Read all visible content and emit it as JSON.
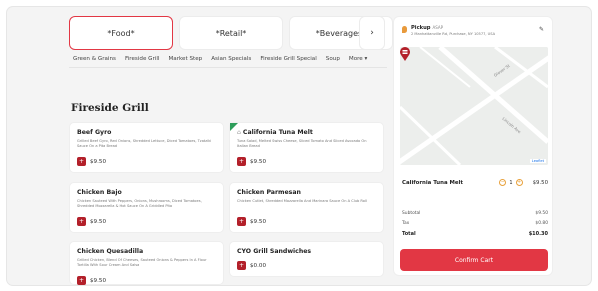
{
  "categories": [
    {
      "label": "*Food*",
      "active": true
    },
    {
      "label": "*Retail*",
      "active": false
    },
    {
      "label": "*Beverages*",
      "active": false
    }
  ],
  "category_next": "›",
  "subcategories": [
    "Green & Grains",
    "Fireside Grill",
    "Market Step",
    "Asian Specials",
    "Fireside Grill Special",
    "Soup",
    "More ▾"
  ],
  "section_title": "Fireside Grill",
  "items": [
    {
      "name": "Beef Gyro",
      "desc": "Grilled Beef Gyro, Red Onions, Shredded Lettuce, Diced Tomatoes, Tzatziki Sauce On a Pita Bread",
      "price": "$9.50"
    },
    {
      "name": "California Tuna Melt",
      "desc": "Tuna Salad, Melted Swiss Cheese, Sliced Tomato And Sliced Avocado On Italian Bread",
      "price": "$9.50"
    },
    {
      "name": "Chicken Bajo",
      "desc": "Chicken Sauteed With Peppers, Onions, Mushrooms, Diced Tomatoes, Shredded Mozzarella & Hot Sauce On A Griddled Pita",
      "price": "$9.50"
    },
    {
      "name": "Chicken Parmesan",
      "desc": "Chicken Cutlet, Shredded Mozzarella And Marinara Sauce On A Club Roll",
      "price": "$9.50"
    },
    {
      "name": "Chicken Quesadilla",
      "desc": "Grilled Chicken, Blend Of Cheeses, Sauteed Onions & Peppers In A Flour Tortilla With Sour Cream And Salsa",
      "price": "$9.50"
    },
    {
      "name": "CYO Grill Sandwiches",
      "desc": "",
      "price": "$0.00"
    }
  ],
  "cart": {
    "pickup_label": "Pickup",
    "pickup_time": "ASAP",
    "address": "2 Manhattanville Rd, Purchase, NY 10577, USA",
    "map_attribution": "Leaflet",
    "item_name": "California Tuna Melt",
    "qty": "1",
    "item_price": "$9.50",
    "subtotal_label": "Subtotal",
    "subtotal": "$9.50",
    "tax_label": "Tax",
    "tax": "$0.80",
    "total_label": "Total",
    "total": "$10.30",
    "confirm_label": "Confirm Cart"
  },
  "colors": {
    "accent": "#e23744",
    "button_dark": "#b3202a",
    "qty_accent": "#e8a13c"
  }
}
